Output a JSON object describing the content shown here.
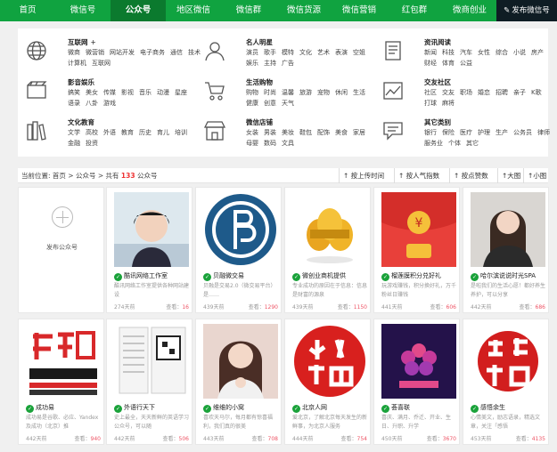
{
  "nav": {
    "items": [
      {
        "label": "首页",
        "active": false
      },
      {
        "label": "微信号",
        "active": false
      },
      {
        "label": "公众号",
        "active": true
      },
      {
        "label": "地区微信",
        "active": false
      },
      {
        "label": "微信群",
        "active": false
      },
      {
        "label": "微信货源",
        "active": false
      },
      {
        "label": "微信营销",
        "active": false
      },
      {
        "label": "红包群",
        "active": false
      },
      {
        "label": "微商创业",
        "active": false
      }
    ],
    "publish_label": "发布微信号"
  },
  "categories": [
    {
      "icon": "globe-icon",
      "title": "互联网",
      "plus": "+",
      "links": [
        "微商",
        "微营销",
        "网站开发",
        "电子商务",
        "通信",
        "技术",
        "计算机",
        "互联网"
      ]
    },
    {
      "icon": "person-icon",
      "title": "名人明星",
      "plus": "",
      "links": [
        "演员",
        "歌手",
        "模特",
        "文化",
        "艺术",
        "表演",
        "空姐",
        "娱乐",
        "主持",
        "广告"
      ]
    },
    {
      "icon": "book-icon",
      "title": "资讯阅读",
      "plus": "",
      "links": [
        "新闻",
        "科技",
        "汽车",
        "女性",
        "综合",
        "小说",
        "房产",
        "财经",
        "体育",
        "公益"
      ]
    },
    {
      "icon": "film-icon",
      "title": "影音娱乐",
      "plus": "",
      "links": [
        "搞笑",
        "美女",
        "传媒",
        "影视",
        "音乐",
        "动漫",
        "星座",
        "语录",
        "八卦",
        "游戏"
      ]
    },
    {
      "icon": "cart-icon",
      "title": "生活购物",
      "plus": "",
      "links": [
        "购物",
        "时尚",
        "温馨",
        "旅游",
        "宠物",
        "休闲",
        "生活",
        "健康",
        "创意",
        "天气"
      ]
    },
    {
      "icon": "chart-icon",
      "title": "交友社区",
      "plus": "",
      "links": [
        "社区",
        "交友",
        "职场",
        "婚恋",
        "招聘",
        "亲子",
        "K歌",
        "打球",
        "麻将"
      ]
    },
    {
      "icon": "books-icon",
      "title": "文化教育",
      "plus": "",
      "links": [
        "文学",
        "高校",
        "外语",
        "教育",
        "历史",
        "育儿",
        "培训",
        "金融",
        "投资"
      ]
    },
    {
      "icon": "store-icon",
      "title": "微信店铺",
      "plus": "",
      "links": [
        "女装",
        "男装",
        "美妆",
        "鞋包",
        "配饰",
        "美食",
        "家居",
        "母婴",
        "数码",
        "文具"
      ]
    },
    {
      "icon": "chat-icon",
      "title": "其它类别",
      "plus": "",
      "links": [
        "银行",
        "保险",
        "医疗",
        "护理",
        "生产",
        "公务员",
        "律师",
        "服务业",
        "个体",
        "其它"
      ]
    }
  ],
  "breadcrumb": {
    "prefix": "当前位置: 首页 > 公众号 > 共有",
    "count": "133",
    "suffix": "公众号"
  },
  "sort": [
    "按上传时间",
    "按人气指数",
    "按点赞数",
    "大图",
    "小图"
  ],
  "add_card": {
    "label": "发布公众号"
  },
  "meta_view_label": "查看：",
  "cards": [
    {
      "title": "酷讯网络工作室",
      "desc": "酷讯网络工作室提供各种网站建设",
      "time": "274天前",
      "views": "16"
    },
    {
      "title": "贝融微交易",
      "desc": "贝融是交易2.0（微交易平台）是……",
      "time": "439天前",
      "views": "1290"
    },
    {
      "title": "微创业商机提供",
      "desc": "专业成功的原因在于信息：信息是财富的源泉",
      "time": "439天前",
      "views": "1150"
    },
    {
      "title": "榴莲膜积分兑好礼",
      "desc": "玩游戏赚钱，积分换好礼，万千粉丝日赚钱",
      "time": "441天前",
      "views": "606"
    },
    {
      "title": "哈尔滨说说时光SPA",
      "desc": "是啦我们的生活心愿！都好养生养护，可以分享",
      "time": "442天前",
      "views": "686"
    },
    {
      "title": "成功易",
      "desc": "成功易是谷歌、必应、Yandex及成功（北京）推",
      "time": "442天前",
      "views": "940"
    },
    {
      "title": "外语行天下",
      "desc": "史上最全，天天新鲜的英语学习公众号，可以随",
      "time": "442天前",
      "views": "506"
    },
    {
      "title": "维维的小窝",
      "desc": "喜欢天马尔，每月都有惊喜福利，我们真的很美",
      "time": "443天前",
      "views": "708"
    },
    {
      "title": "北京人网",
      "desc": "爱北京，了解北京每天发生的新鲜事，为北京人服务",
      "time": "444天前",
      "views": "754"
    },
    {
      "title": "荟喜联",
      "desc": "喜庆、满月、乔迁、开业、生日、升职、升学",
      "time": "450天前",
      "views": "3670"
    },
    {
      "title": "感悟余生",
      "desc": "心情美文，励志语录，精选文章，关注「感悟",
      "time": "453天前",
      "views": "4135"
    }
  ]
}
